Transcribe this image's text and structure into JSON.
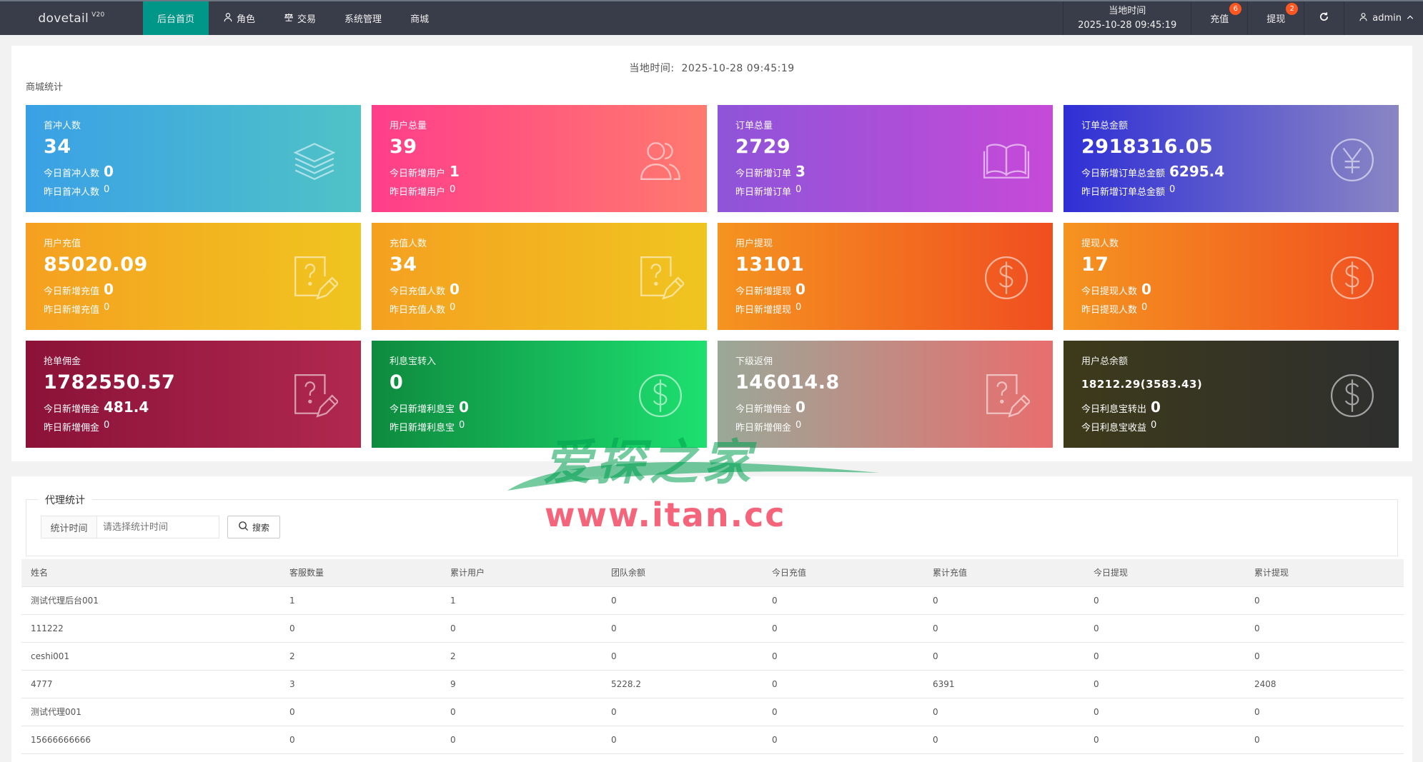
{
  "header": {
    "logo": "dovetail",
    "version": "V20",
    "nav": [
      {
        "label": "后台首页",
        "icon": "none",
        "active": true
      },
      {
        "label": "角色",
        "icon": "user-icon",
        "active": false
      },
      {
        "label": "交易",
        "icon": "scale-icon",
        "active": false
      },
      {
        "label": "系统管理",
        "icon": "none",
        "active": false
      },
      {
        "label": "商城",
        "icon": "none",
        "active": false
      }
    ],
    "time_label": "当地时间",
    "time_value": "2025-10-28 09:45:19",
    "recharge_label": "充值",
    "recharge_badge": "6",
    "withdraw_label": "提现",
    "withdraw_badge": "2",
    "user": "admin"
  },
  "stats": {
    "local_time_label": "当地时间:",
    "local_time_value": "2025-10-28 09:45:19",
    "section_label": "商城统计",
    "cards": [
      {
        "title": "首冲人数",
        "value": "34",
        "line1_label": "今日首冲人数",
        "line1_value": "0",
        "line2_label": "昨日首冲人数",
        "line2_value": "0",
        "icon": "layers-icon",
        "gradient": [
          "#3aa0e6",
          "#4fc3c6"
        ]
      },
      {
        "title": "用户总量",
        "value": "39",
        "line1_label": "今日新增用户",
        "line1_value": "1",
        "line2_label": "昨日新增用户",
        "line2_value": "0",
        "icon": "users-icon",
        "gradient": [
          "#ff3e8a",
          "#ff7a6e"
        ]
      },
      {
        "title": "订单总量",
        "value": "2729",
        "line1_label": "今日新增订单",
        "line1_value": "3",
        "line2_label": "昨日新增订单",
        "line2_value": "0",
        "icon": "book-icon",
        "gradient": [
          "#8e54d9",
          "#c64ad8"
        ]
      },
      {
        "title": "订单总金额",
        "value": "2918316.05",
        "line1_label": "今日新增订单总金额",
        "line1_value": "6295.4",
        "line2_label": "昨日新增订单总金额",
        "line2_value": "0",
        "icon": "yen-icon",
        "gradient": [
          "#2f2fd6",
          "#8a86c4"
        ]
      },
      {
        "title": "用户充值",
        "value": "85020.09",
        "line1_label": "今日新增充值",
        "line1_value": "0",
        "line2_label": "昨日新增充值",
        "line2_value": "0",
        "icon": "question-edit-icon",
        "gradient": [
          "#f5a020",
          "#f0c520"
        ]
      },
      {
        "title": "充值人数",
        "value": "34",
        "line1_label": "今日充值人数",
        "line1_value": "0",
        "line2_label": "昨日充值人数",
        "line2_value": "0",
        "icon": "question-edit-icon",
        "gradient": [
          "#f5a020",
          "#f0c520"
        ]
      },
      {
        "title": "用户提现",
        "value": "13101",
        "line1_label": "今日新增提现",
        "line1_value": "0",
        "line2_label": "昨日新增提现",
        "line2_value": "0",
        "icon": "dollar-icon",
        "gradient": [
          "#f59420",
          "#f04e20"
        ]
      },
      {
        "title": "提现人数",
        "value": "17",
        "line1_label": "今日提现人数",
        "line1_value": "0",
        "line2_label": "昨日提现人数",
        "line2_value": "0",
        "icon": "dollar-icon",
        "gradient": [
          "#f59420",
          "#f04e20"
        ]
      },
      {
        "title": "抢单佣金",
        "value": "1782550.57",
        "line1_label": "今日新增佣金",
        "line1_value": "481.4",
        "line2_label": "昨日新增佣金",
        "line2_value": "0",
        "icon": "question-edit-icon",
        "gradient": [
          "#8b1238",
          "#b0284f"
        ]
      },
      {
        "title": "利息宝转入",
        "value": "0",
        "line1_label": "今日新增利息宝",
        "line1_value": "0",
        "line2_label": "昨日新增利息宝",
        "line2_value": "0",
        "icon": "dollar-icon",
        "gradient": [
          "#0e8a3e",
          "#1de070"
        ]
      },
      {
        "title": "下级返佣",
        "value": "146014.8",
        "line1_label": "今日新增佣金",
        "line1_value": "0",
        "line2_label": "昨日新增佣金",
        "line2_value": "0",
        "icon": "question-edit-icon",
        "gradient": [
          "#9aa898",
          "#e86e6e"
        ]
      },
      {
        "title": "用户总余额",
        "value": "18212.29(3583.43)",
        "value_small": true,
        "line1_label": "今日利息宝转出",
        "line1_value": "0",
        "line2_label": "今日利息宝收益",
        "line2_value": "0",
        "icon": "dollar-icon",
        "gradient": [
          "#3d3a1a",
          "#2e2f2f"
        ]
      }
    ]
  },
  "agent": {
    "legend": "代理统计",
    "filter_label": "统计时间",
    "filter_placeholder": "请选择统计时间",
    "search_label": "搜索",
    "columns": [
      "姓名",
      "客服数量",
      "累计用户",
      "团队余额",
      "今日充值",
      "累计充值",
      "今日提现",
      "累计提现"
    ],
    "rows": [
      [
        "测试代理后台001",
        "1",
        "1",
        "0",
        "0",
        "0",
        "0",
        "0"
      ],
      [
        "111222",
        "0",
        "0",
        "0",
        "0",
        "0",
        "0",
        "0"
      ],
      [
        "ceshi001",
        "2",
        "2",
        "0",
        "0",
        "0",
        "0",
        "0"
      ],
      [
        "4777",
        "3",
        "9",
        "5228.2",
        "0",
        "6391",
        "0",
        "2408"
      ],
      [
        "测试代理001",
        "0",
        "0",
        "0",
        "0",
        "0",
        "0",
        "0"
      ],
      [
        "15666666666",
        "0",
        "0",
        "0",
        "0",
        "0",
        "0",
        "0"
      ]
    ]
  },
  "watermark": {
    "text_cn": "爱探之家",
    "url": "www.itan.cc"
  }
}
